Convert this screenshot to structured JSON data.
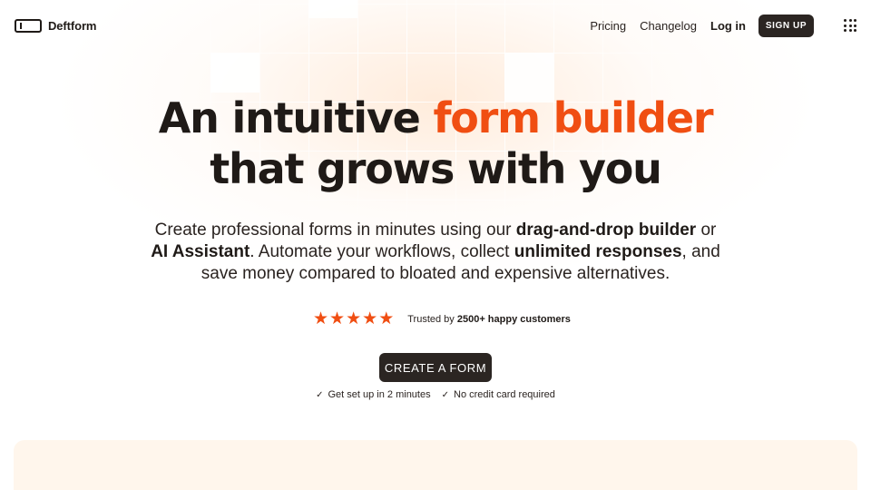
{
  "header": {
    "brand": "Deftform",
    "nav": {
      "pricing": "Pricing",
      "changelog": "Changelog",
      "login": "Log in",
      "signup": "SIGN UP"
    },
    "apps_icon": "grid-dots-icon"
  },
  "hero": {
    "headline_part1": "An intuitive ",
    "headline_accent": "form builder",
    "headline_part2": "that grows with you",
    "sub": {
      "t1": "Create professional forms in minutes using our ",
      "b1": "drag-and-drop builder",
      "t2": " or",
      "b2": "AI Assistant",
      "t3": ". Automate your workflows, collect ",
      "b3": "unlimited responses",
      "t4": ", and",
      "t5": "save money compared to bloated and expensive alternatives."
    },
    "rating": {
      "stars": 5,
      "star_icon": "star-icon",
      "trusted_prefix": "Trusted by ",
      "trusted_bold": "2500+ happy customers"
    },
    "cta": "CREATE A FORM",
    "perks": [
      "Get set up in 2 minutes",
      "No credit card required"
    ]
  },
  "colors": {
    "accent": "#f04e12",
    "dark": "#2b2522",
    "panel": "#fff6ec"
  }
}
